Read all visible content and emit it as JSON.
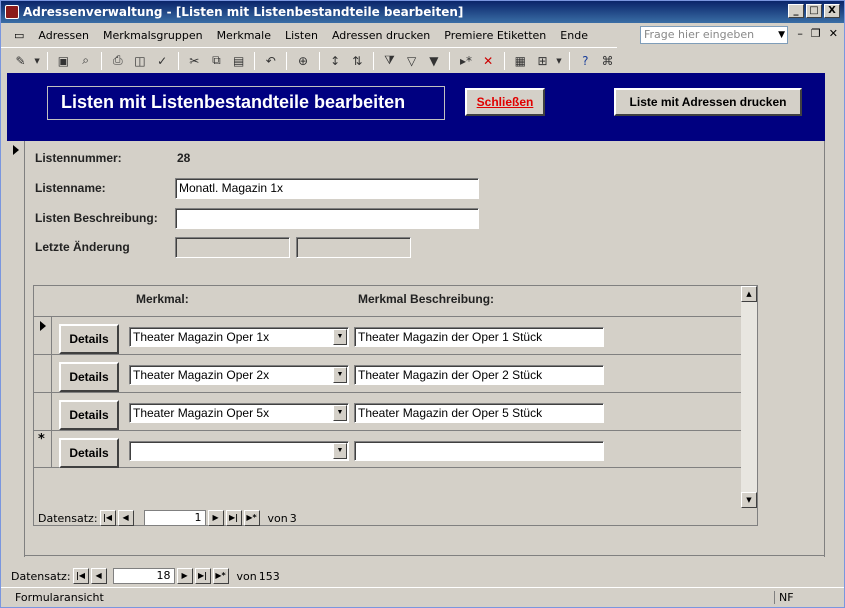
{
  "window": {
    "title": "Adressenverwaltung - [Listen mit Listenbestandteile bearbeiten]",
    "controls": [
      "_",
      "□",
      "X"
    ]
  },
  "menu": {
    "items": [
      "Adressen",
      "Merkmalsgruppen",
      "Merkmale",
      "Listen",
      "Adressen drucken",
      "Premiere Etiketten",
      "Ende"
    ],
    "ask_placeholder": "Frage hier eingeben"
  },
  "toolbar": {
    "icons": [
      "design-view-icon",
      "save-icon",
      "search-icon",
      "print-icon",
      "print-preview-icon",
      "spelling-icon",
      "cut-icon",
      "copy-icon",
      "paste-icon",
      "undo-icon",
      "hyperlink-icon",
      "sort-ascending-icon",
      "sort-descending-icon",
      "filter-by-selection-icon",
      "filter-by-form-icon",
      "apply-filter-icon",
      "new-record-icon",
      "delete-record-icon",
      "database-window-icon",
      "new-object-icon",
      "help-icon",
      "find-icon"
    ]
  },
  "header": {
    "title": "Listen mit Listenbestandteile bearbeiten",
    "close_button": "Schließen",
    "print_button": "Liste mit Adressen drucken"
  },
  "form": {
    "list_number_label": "Listennummer:",
    "list_number_value": "28",
    "list_name_label": "Listenname:",
    "list_name_value": "Monatl. Magazin 1x",
    "description_label": "Listen Beschreibung:",
    "description_value": "",
    "last_change_label": "Letzte Änderung"
  },
  "subform": {
    "col_feature": "Merkmal:",
    "col_description": "Merkmal Beschreibung:",
    "details_label": "Details",
    "rows": [
      {
        "feature": "Theater Magazin Oper 1x",
        "description": "Theater Magazin der Oper 1 Stück"
      },
      {
        "feature": "Theater Magazin Oper 2x",
        "description": "Theater Magazin der Oper 2 Stück"
      },
      {
        "feature": "Theater Magazin Oper 5x",
        "description": "Theater Magazin der Oper 5 Stück"
      },
      {
        "feature": "",
        "description": ""
      }
    ],
    "nav": {
      "label": "Datensatz:",
      "current": "1",
      "of_label": "von",
      "total": "3"
    }
  },
  "main_nav": {
    "label": "Datensatz:",
    "current": "18",
    "of_label": "von",
    "total": "153"
  },
  "status": {
    "text": "Formularansicht",
    "mode": "NF"
  }
}
